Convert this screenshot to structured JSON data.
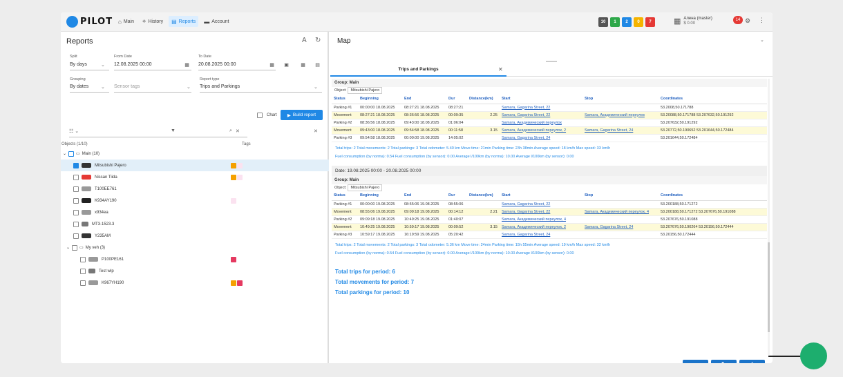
{
  "app": {
    "logo": "PILOT"
  },
  "nav": [
    {
      "label": "Main",
      "icon": "home-icon"
    },
    {
      "label": "History",
      "icon": "route-icon"
    },
    {
      "label": "Reports",
      "icon": "document-icon",
      "active": true
    },
    {
      "label": "Account",
      "icon": "card-icon"
    }
  ],
  "status_badges": [
    {
      "value": "10",
      "color": "#555555"
    },
    {
      "value": "1",
      "color": "#2ea84a"
    },
    {
      "value": "2",
      "color": "#1f88e5"
    },
    {
      "value": "0",
      "color": "#f5b400"
    },
    {
      "value": "7",
      "color": "#e53935"
    }
  ],
  "user": {
    "name": "Алена (master)",
    "balance": "$ 0.00",
    "notifications": "14"
  },
  "reports": {
    "title": "Reports",
    "split_label": "Split",
    "split_value": "By days",
    "from_label": "From Date",
    "from_value": "12.08.2025 00:00",
    "to_label": "To Date",
    "to_value": "20.08.2025 00:00",
    "grouping_label": "Grouping",
    "grouping_value": "By dates",
    "sensor_tags_placeholder": "Sensor tags",
    "report_type_label": "Report type",
    "report_type_value": "Trips and Parkings",
    "chart_label": "Chart",
    "build_label": "Build report",
    "objects_label": "Objects (1/10)",
    "tags_label": "Tags",
    "tree": [
      {
        "label": "Main (10)",
        "group": true
      },
      {
        "label": "Mitsubishi Pajero",
        "checked": true,
        "tags": [
          "#f5a000",
          "#fbe2f0"
        ],
        "selected": true
      },
      {
        "label": "Nissan Tiida",
        "tags": [
          "#f5a000",
          "#fbe2f0"
        ]
      },
      {
        "label": "T100EE761",
        "tags": []
      },
      {
        "label": "K934AY190",
        "tags": [
          "#fbe2f0"
        ]
      },
      {
        "label": "x934ea",
        "tags": []
      },
      {
        "label": "MT3-1523.3",
        "tags": []
      },
      {
        "label": "Y235AM",
        "tags": []
      },
      {
        "label": "My veh (3)",
        "group": true
      },
      {
        "label": "P100PE161",
        "tags": [
          "#e53960"
        ]
      },
      {
        "label": "Test wlp",
        "tags": []
      },
      {
        "label": "K967YH190",
        "tags": [
          "#f5a000",
          "#e53960"
        ]
      }
    ]
  },
  "map": {
    "title": "Map",
    "tab_label": "Trips and Parkings"
  },
  "report": {
    "group_label": "Group: Main",
    "object_label": "Object:",
    "object_value": "Mitsubishi Pajero",
    "columns": [
      "Status",
      "Beginning",
      "End",
      "Dur",
      "Distance(km)",
      "Start",
      "Stop",
      "Coordinates"
    ],
    "day1": {
      "rows": [
        [
          "Parking #1",
          "00:00:00 18.08.2025",
          "08:27:21 18.08.2025",
          "08:27:21",
          "",
          "Samara, Gagarina Street, 22",
          "",
          "53.2008,50.171788"
        ],
        [
          "Movement",
          "08:27:21 18.08.2025",
          "08:36:56 18.08.2025",
          "00:09:35",
          "2.25",
          "Samara, Gagarina Street, 22",
          "Samara, Академический переулок",
          "53.20088,50.171788 53.207632,50.191292"
        ],
        [
          "Parking #2",
          "08:36:56 18.08.2025",
          "09:43:00 18.08.2025",
          "01:06:04",
          "",
          "Samara, Академический переулок",
          "",
          "53.207632,50.191292"
        ],
        [
          "Movement",
          "09:43:00 18.08.2025",
          "09:54:58 18.08.2025",
          "00:11:58",
          "3.15",
          "Samara, Академический переулок, 2",
          "Samara, Gagarina Street, 24",
          "53.20772,50.190652 53.201644,50.172484"
        ],
        [
          "Parking #3",
          "09:54:58 18.08.2025",
          "00:00:00 19.08.2025",
          "14:05:02",
          "",
          "Samara, Gagarina Street, 24",
          "",
          "53.201644,50.172484"
        ]
      ],
      "summary1": "Total trips: 2   Total movements: 2   Total parkings: 3   Total odometer: 5.40 km   Move time: 21min   Parking time: 23h 38min   Average speed: 18 km/h   Max speed: 33 km/h",
      "summary2": "Fuel consumption (by norma): 0.54   Fuel consumption (by sensor): 0.00   Average l/100km (by norma): 10.00   Average l/100km (by sensor): 0.00"
    },
    "day2": {
      "date": "Date: 19.08.2025 00:00 - 20.08.2025 00:00",
      "rows": [
        [
          "Parking #1",
          "00:00:00 19.08.2025",
          "08:55:06 19.08.2025",
          "08:55:06",
          "",
          "Samara, Gagarina Street, 22",
          "",
          "53.200188,50.171272"
        ],
        [
          "Movement",
          "08:55:06 19.08.2025",
          "09:09:18 19.08.2025",
          "00:14:12",
          "2.21",
          "Samara, Gagarina Street, 22",
          "Samara, Академический переулок, 4",
          "53.200188,50.171272 53.207676,50.191088"
        ],
        [
          "Parking #2",
          "09:09:18 19.08.2025",
          "10:49:25 19.08.2025",
          "01:40:07",
          "",
          "Samara, Академический переулок, 4",
          "",
          "53.207676,50.191088"
        ],
        [
          "Movement",
          "10:49:25 19.08.2025",
          "10:59:17 19.08.2025",
          "00:09:52",
          "3.15",
          "Samara, Академический переулок, 2",
          "Samara, Gagarina Street, 24",
          "53.207676,50.190264 53.20156,50.172444"
        ],
        [
          "Parking #3",
          "10:59:17 19.08.2025",
          "16:19:59 19.08.2025",
          "05:20:42",
          "",
          "Samara, Gagarina Street, 24",
          "",
          "53.20156,50.172444"
        ]
      ],
      "summary1": "Total trips: 2   Total movements: 2   Total parkings: 3   Total odometer: 5.36 km   Move time: 24min   Parking time: 15h 55min   Average speed: 19 km/h   Max speed: 32 km/h",
      "summary2": "Fuel consumption (by norma): 0.54   Fuel consumption (by sensor): 0.00   Average l/100km (by norma): 10.00   Average l/100km (by sensor): 0.00"
    },
    "totals": [
      "Total trips for period: 6",
      "Total movements for period: 7",
      "Total parkings for period: 10"
    ]
  }
}
